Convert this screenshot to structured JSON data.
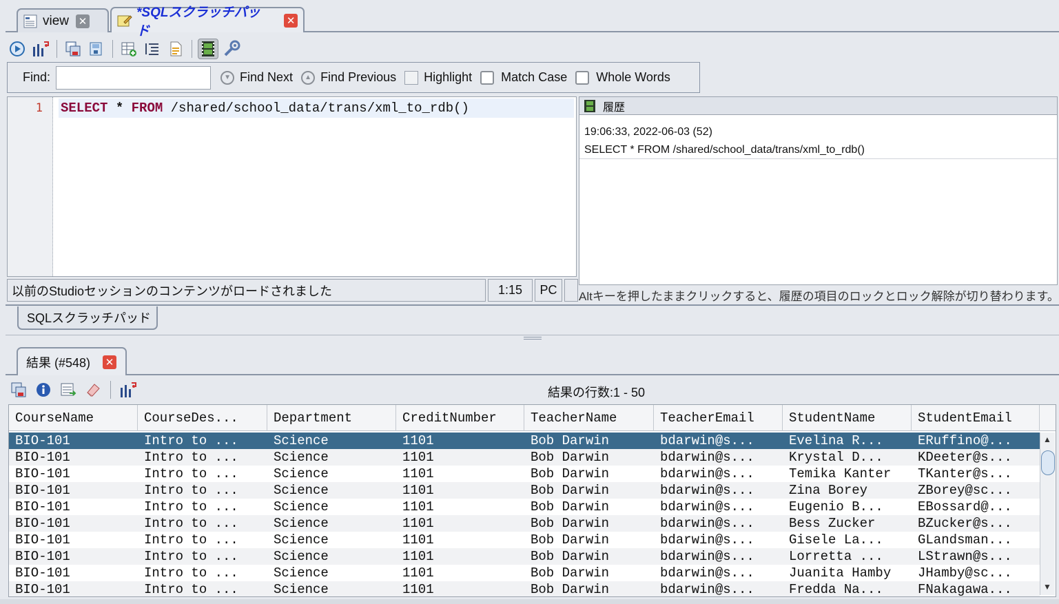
{
  "tabs": [
    {
      "title": "view",
      "active": false
    },
    {
      "title": "*SQLスクラッチパッド",
      "active": true
    }
  ],
  "toolbar": {
    "icons": [
      "run-icon",
      "query-plan-icon",
      "save-icon",
      "save-as-icon",
      "add-table-icon",
      "format-icon",
      "export-icon",
      "history-icon",
      "settings-icon"
    ]
  },
  "findbar": {
    "find_label": "Find:",
    "find_value": "",
    "find_next": "Find Next",
    "find_previous": "Find Previous",
    "highlight": "Highlight",
    "match_case": "Match Case",
    "whole_words": "Whole Words"
  },
  "editor": {
    "line_number": "1",
    "kw_select": "SELECT",
    "star": "*",
    "kw_from": "FROM",
    "path": "/shared/school_data/trans/xml_to_rdb()"
  },
  "history": {
    "title": "履歴",
    "entry_time": "19:06:33,  2022-06-03  (52)",
    "entry_query": "SELECT * FROM /shared/school_data/trans/xml_to_rdb()",
    "hint": "Altキーを押したままクリックすると、履歴の項目のロックとロック解除が切り替わります。"
  },
  "status": {
    "message": "以前のStudioセッションのコンテンツがロードされました",
    "position": "1:15",
    "mode": "PC"
  },
  "bottom_tab": "SQLスクラッチパッド",
  "results": {
    "tab_title": "結果 (#548)",
    "row_count": "結果の行数:1 - 50",
    "toolbar_icons": [
      "save-results-icon",
      "info-icon",
      "export-results-icon",
      "clear-icon",
      "query-plan-icon"
    ],
    "columns": [
      "CourseName",
      "CourseDes...",
      "Department",
      "CreditNumber",
      "TeacherName",
      "TeacherEmail",
      "StudentName",
      "StudentEmail"
    ],
    "rows": [
      [
        "BIO-101",
        "Intro to ...",
        "Science",
        "1101",
        "Bob Darwin",
        "bdarwin@s...",
        "Evelina R...",
        "ERuffino@..."
      ],
      [
        "BIO-101",
        "Intro to ...",
        "Science",
        "1101",
        "Bob Darwin",
        "bdarwin@s...",
        "Krystal D...",
        "KDeeter@s..."
      ],
      [
        "BIO-101",
        "Intro to ...",
        "Science",
        "1101",
        "Bob Darwin",
        "bdarwin@s...",
        "Temika Kanter",
        "TKanter@s..."
      ],
      [
        "BIO-101",
        "Intro to ...",
        "Science",
        "1101",
        "Bob Darwin",
        "bdarwin@s...",
        "Zina Borey",
        "ZBorey@sc..."
      ],
      [
        "BIO-101",
        "Intro to ...",
        "Science",
        "1101",
        "Bob Darwin",
        "bdarwin@s...",
        "Eugenio B...",
        "EBossard@..."
      ],
      [
        "BIO-101",
        "Intro to ...",
        "Science",
        "1101",
        "Bob Darwin",
        "bdarwin@s...",
        "Bess Zucker",
        "BZucker@s..."
      ],
      [
        "BIO-101",
        "Intro to ...",
        "Science",
        "1101",
        "Bob Darwin",
        "bdarwin@s...",
        "Gisele La...",
        "GLandsman..."
      ],
      [
        "BIO-101",
        "Intro to ...",
        "Science",
        "1101",
        "Bob Darwin",
        "bdarwin@s...",
        "Lorretta ...",
        "LStrawn@s..."
      ],
      [
        "BIO-101",
        "Intro to ...",
        "Science",
        "1101",
        "Bob Darwin",
        "bdarwin@s...",
        "Juanita Hamby",
        "JHamby@sc..."
      ],
      [
        "BIO-101",
        "Intro to ...",
        "Science",
        "1101",
        "Bob Darwin",
        "bdarwin@s...",
        "Fredda Na...",
        "FNakagawa..."
      ]
    ],
    "selected_row": 0
  }
}
